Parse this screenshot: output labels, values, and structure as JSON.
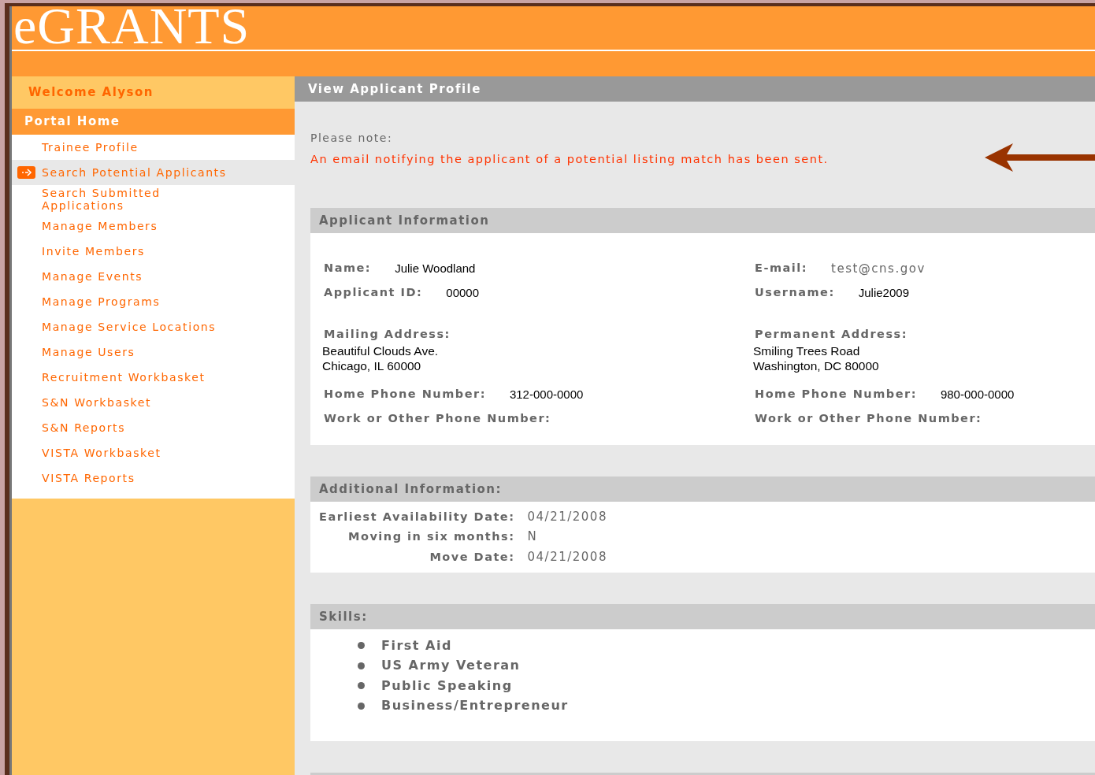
{
  "logo": "eGRANTS",
  "sidebar": {
    "welcome": "Welcome Alyson",
    "home": "Portal Home",
    "items": [
      {
        "label": "Trainee Profile",
        "selected": false
      },
      {
        "label": "Search Potential Applicants",
        "selected": true
      },
      {
        "label": "Search Submitted\nApplications",
        "selected": false
      },
      {
        "label": "Manage Members",
        "selected": false
      },
      {
        "label": "Invite Members",
        "selected": false
      },
      {
        "label": "Manage Events",
        "selected": false
      },
      {
        "label": "Manage Programs",
        "selected": false
      },
      {
        "label": "Manage Service Locations",
        "selected": false
      },
      {
        "label": "Manage Users",
        "selected": false
      },
      {
        "label": "Recruitment Workbasket",
        "selected": false
      },
      {
        "label": "S&N Workbasket",
        "selected": false
      },
      {
        "label": "S&N Reports",
        "selected": false
      },
      {
        "label": "VISTA Workbasket",
        "selected": false
      },
      {
        "label": "VISTA Reports",
        "selected": false
      }
    ]
  },
  "page_title": "View Applicant Profile",
  "note": {
    "heading": "Please note:",
    "message": "An email notifying the applicant of a potential listing match has been sent."
  },
  "applicant_information": {
    "title": "Applicant Information",
    "columns": [
      [
        {
          "kind": "pair",
          "label": "Name:",
          "value": "Julie Woodland"
        },
        {
          "kind": "pair",
          "label": "Applicant ID:",
          "value": "00000"
        },
        {
          "kind": "address",
          "label": "Mailing Address:",
          "lines": [
            "Beautiful Clouds Ave.",
            "Chicago, IL 60000"
          ]
        },
        {
          "kind": "pair",
          "label": "Home Phone Number:",
          "value": "312-000-0000"
        },
        {
          "kind": "pair",
          "label": "Work or Other Phone Number:"
        }
      ],
      [
        {
          "kind": "pair",
          "label": "E-mail:",
          "value": "test@cns.gov",
          "muted": true
        },
        {
          "kind": "pair",
          "label": "Username:",
          "value": "Julie2009"
        },
        {
          "kind": "address",
          "label": "Permanent Address:",
          "lines": [
            "Smiling Trees Road",
            "Washington, DC 80000"
          ]
        },
        {
          "kind": "pair",
          "label": "Home Phone Number:",
          "value": "980-000-0000"
        },
        {
          "kind": "pair",
          "label": "Work or Other Phone Number:"
        }
      ]
    ]
  },
  "additional_information": {
    "title": "Additional Information:",
    "rows": [
      {
        "label": "Earliest Availability Date:",
        "value": "04/21/2008"
      },
      {
        "label": "Moving in six months:",
        "value": "N"
      },
      {
        "label": "Move Date:",
        "value": "04/21/2008"
      }
    ]
  },
  "skills": {
    "title": "Skills:",
    "items": [
      "First Aid",
      "US Army Veteran",
      "Public Speaking",
      "Business/Entrepreneur"
    ]
  }
}
